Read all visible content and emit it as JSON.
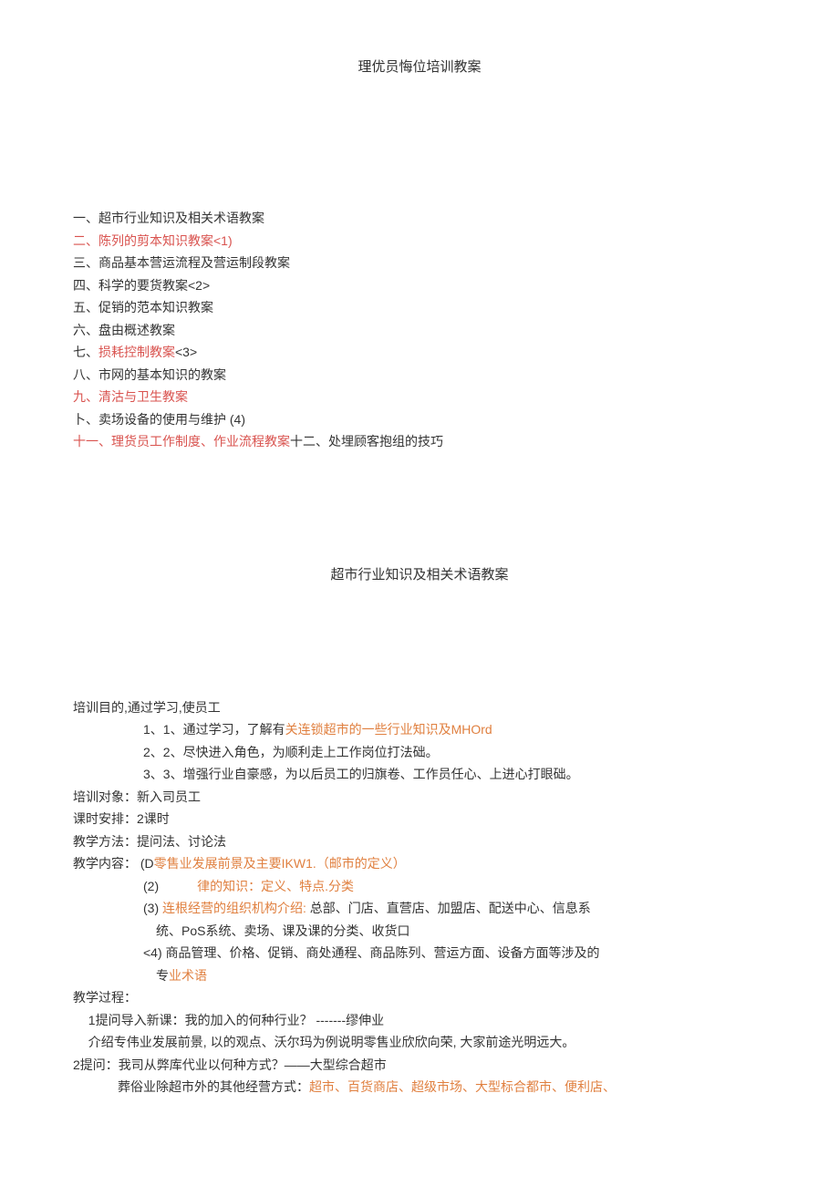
{
  "title": "理优员悔位培训教案",
  "toc": [
    {
      "pre": "一、超市行业知识及相关术语教案",
      "red": ""
    },
    {
      "pre": "",
      "red": "二、陈列的剪本知识教案<1)"
    },
    {
      "pre": "三、商品基本营运流程及营运制段教案",
      "red": ""
    },
    {
      "pre": "四、科学的要货教案<2>",
      "red": ""
    },
    {
      "pre": "五、促销的范本知识教案",
      "red": ""
    },
    {
      "pre": "六、盘由概述教案",
      "red": ""
    },
    {
      "pre": "七、",
      "red": "损耗控制教案",
      "suf": "<3>"
    },
    {
      "pre": "八、市网的基本知识的教案",
      "red": ""
    },
    {
      "pre": "",
      "red": "九、清沽与卫生教案"
    },
    {
      "pre": "卜、卖场设备的使用与维护  (4)",
      "red": ""
    },
    {
      "pre": "",
      "red": "十一、理货员工作制度、作业流程教案",
      "suf": "十二、处埋顾客抱组的技巧"
    }
  ],
  "subtitle": "超市行业知识及相关术语教案",
  "goal_label": "培训目的,通过学习,使员工",
  "goal_1a": "1、1、通过学习，了解有",
  "goal_1b": "关连锁超市的一些行业知识及MHOrd",
  "goal_2": "2、2、尽快进入角色，为顺利走上工作岗位打法础。",
  "goal_3": "3、3、增强行业自豪感，为以后员工的归旗卷、工作员任心、上进心打眼础。",
  "target": "培训对象：新入司员工",
  "hours": "课时安排：2课时",
  "method": "教学方法：提问法、讨论法",
  "content_label": "教学内容：  (D",
  "content_1a": "零售业发展前景及主要IKW1.",
  "content_1b": "（邮市的定义）",
  "content_2a": "(2)",
  "content_2b": "律的知识：定义、特点.分类",
  "content_3a": "(3) ",
  "content_3b": "连根经营的组织机构介绍:",
  "content_3c": " 总部、门店、直营店、加盟店、配送中心、信息系",
  "content_3d": "统、PoS系统、卖场、课及课的分类、收货口",
  "content_4a": "<4) 商品管理、价格、促销、商处通程、商品陈列、营运方面、设备方面等涉及的",
  "content_4b": "专",
  "content_4c": "业术语",
  "process_label": "教学过程：",
  "process_1a": "1提问导入新课：我的加入的何种行业？  -------缪伸业",
  "process_1b": "介绍专伟业发展前景, 以的观点、沃尔玛为例说明零售业欣欣向荣, 大家前途光明远大。",
  "process_2a": "2提问：我司从弊库代业以何种方式？——大型综合超市",
  "process_2b_pre": "葬俗业除超市外的其他经营方式：",
  "process_2b_red": "超市、百货商店、超级市场、大型标合都市、便利店、"
}
